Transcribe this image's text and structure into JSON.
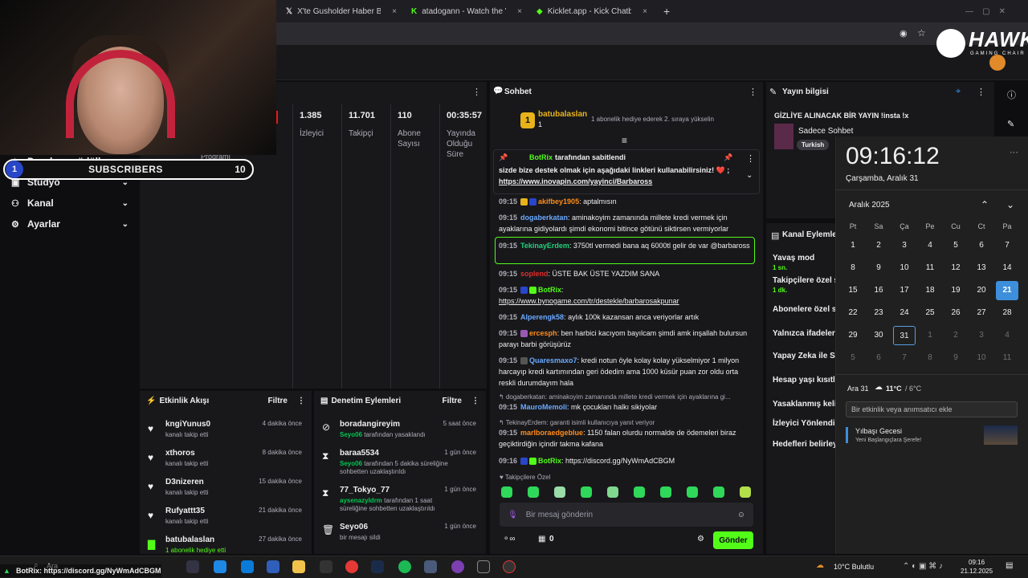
{
  "browser": {
    "tabs": [
      {
        "label": "X'te Gusholder Haber Bülteni: \"",
        "close": "×"
      },
      {
        "label": "atadogann - Watch the VOD o",
        "close": "×"
      },
      {
        "label": "Kicklet.app - Kick Chatbot and",
        "close": "×"
      }
    ],
    "new_tab": "+"
  },
  "overlay": {
    "sub_count_left": "1",
    "subscribers_label": "SUBSCRIBERS",
    "sub_count_right": "10",
    "brand": "HAWK",
    "brand_sub": "GAMING CHAIR",
    "ticker": "BotRix: https://discord.gg/NyWmAdCBGM"
  },
  "sidebar": {
    "items": [
      {
        "label": "Droplar ve ödüller",
        "icon": "gift-icon"
      },
      {
        "label": "Stüdyo",
        "icon": "studio-icon"
      },
      {
        "label": "Kanal",
        "icon": "users-icon"
      },
      {
        "label": "Ayarlar",
        "icon": "gear-icon"
      }
    ],
    "partial_label": "Programı"
  },
  "stats": [
    {
      "value": "1.385",
      "label": "İzleyici"
    },
    {
      "value": "11.701",
      "label": "Takipçi"
    },
    {
      "value": "110",
      "label": "Abone Sayısı"
    },
    {
      "value": "00:35:57",
      "label": "Yayında Olduğu Süre"
    }
  ],
  "feed": {
    "title": "Etkinlik Akışı",
    "filter": "Filtre",
    "items": [
      {
        "name": "kngiYunus0",
        "desc": "kanalı takip etti",
        "time": "4 dakika önce"
      },
      {
        "name": "xthoros",
        "desc": "kanalı takip etti",
        "time": "8 dakika önce"
      },
      {
        "name": "D3nizeren",
        "desc": "kanalı takip etti",
        "time": "15 dakika önce"
      },
      {
        "name": "Rufyattt35",
        "desc": "kanalı takip etti",
        "time": "21 dakika önce"
      },
      {
        "name": "batubalaslan",
        "desc": "1 abonelik hediye etti",
        "time": "27 dakika önce"
      }
    ]
  },
  "modlog": {
    "title": "Denetim Eylemleri",
    "filter": "Filtre",
    "items": [
      {
        "name": "boradangireyim",
        "mod": "Seyo06",
        "desc": "tarafından yasaklandı",
        "time": "5 saat önce",
        "icon": "ban-icon"
      },
      {
        "name": "baraa5534",
        "mod": "Seyo06",
        "desc": "tarafından 5 dakika süreliğine sohbetten uzaklaştırıldı",
        "time": "1 gün önce",
        "icon": "hourglass-icon"
      },
      {
        "name": "77_Tokyo_77",
        "mod": "aysenazyldrm",
        "desc": "tarafından 1 saat süreliğine sohbetten uzaklaştırıldı",
        "time": "1 gün önce",
        "icon": "hourglass-icon"
      },
      {
        "name": "Seyo06",
        "mod": "",
        "desc": "bir mesajı sildi",
        "time": "1 gün önce",
        "icon": "trash-icon"
      }
    ]
  },
  "chat": {
    "title": "Sohbet",
    "gift_user": "batubalaslan",
    "gift_rank": "1",
    "gift_count": "1",
    "gift_text": "1 abonelik hediye ederek 2. sıraya yükselin",
    "pinned_by": "BotRix",
    "pinned_suffix": "tarafından sabitlendi",
    "pinned_text": "sizde bize destek olmak için aşağıdaki linkleri kullanabilirsiniz! ❤️ ;",
    "pinned_link": "https://www.inovapin.com/yayinci/Barbaross",
    "messages": [
      {
        "time": "09:15",
        "user": "akifbey1905",
        "color": "#ff8c1a",
        "text": ": aptalmısın"
      },
      {
        "time": "09:15",
        "user": "dogaberkatan",
        "color": "#6aa9ff",
        "text": ": aminakoyim zamanında millete kredi vermek için ayaklarına gidiyolardı şimdi ekonomi bitince götünü siktirsen vermiyorlar"
      },
      {
        "time": "09:15",
        "user": "TekinayErdem",
        "color": "#21d17a",
        "text": ": 3750tl vermedi bana aq 6000tl gelir de var @barbaross"
      },
      {
        "time": "09:15",
        "user": "soplend",
        "color": "#e02c2c",
        "text": ": ÜSTE BAK ÜSTE YAZDIM SANA"
      },
      {
        "time": "09:15",
        "user": "BotRix",
        "color": "#53fc18",
        "text": ":"
      },
      {
        "time": "",
        "user": "",
        "color": "#efeff1",
        "text": "https://www.bynogame.com/tr/destekle/barbarosakpunar"
      },
      {
        "time": "09:15",
        "user": "Alperengk58",
        "color": "#6aa9ff",
        "text": ": aylık 100k kazansan anca veriyorlar artık"
      },
      {
        "time": "09:15",
        "user": "ercesph",
        "color": "#ff8c1a",
        "text": ": ben harbici kacıyom bayılcam şimdi amk inşallah bulursun parayı barbi görüşürüz"
      },
      {
        "time": "09:15",
        "user": "Quaresmaxo7",
        "color": "#6aa9ff",
        "text": ": kredi notun öyle kolay kolay yükselmiyor 1 milyon harcayıp kredi kartımından geri ödedim ama 1000 küsür puan zor oldu orta reskli durumdayım hala"
      },
      {
        "time": "",
        "user": "",
        "color": "#adadb8",
        "text": "dogaberkatan: aminakoyim zamanında millete kredi vermek için ayaklarına gi..."
      },
      {
        "time": "09:15",
        "user": "MauroMemoli",
        "color": "#6aa9ff",
        "text": ": mk çocukları halkı sikiyolar"
      },
      {
        "time": "",
        "user": "",
        "color": "#adadb8",
        "text": "TekinayErdem: garanti isimli kullanıcıya yanıt veriyor"
      },
      {
        "time": "09:15",
        "user": "marlboraedgeblue",
        "color": "#ff8c1a",
        "text": ": 1150 falan olurdu normalde de ödemeleri biraz geçiktirdiğin içindir takma kafana"
      },
      {
        "time": "09:16",
        "user": "BotRix",
        "color": "#53fc18",
        "text": ": https://discord.gg/NyWmAdCBGM"
      }
    ],
    "emote_label": "Takipçilere Özel",
    "input_placeholder": "Bir mesaj gönderin",
    "points": "0",
    "send_label": "Gönder"
  },
  "stream_info": {
    "title": "Yayın bilgisi",
    "stream_title": "GİZLİYE ALINACAK BİR YAYIN !insta !x",
    "category": "Sadece Sohbet",
    "tag": "Turkish"
  },
  "channel_actions": {
    "title": "Kanal Eylemleri",
    "items": [
      {
        "label": "Yavaş mod",
        "sub": "1 sn."
      },
      {
        "label": "Takipçilere özel so",
        "sub": "1 dk."
      },
      {
        "label": "Abonelere özel so",
        "sub": ""
      },
      {
        "label": "Yalnızca ifadeler",
        "sub": ""
      },
      {
        "label": "Yapay Zeka ile So",
        "sub": ""
      },
      {
        "label": "Hesap yaşı kısıtla",
        "sub": ""
      },
      {
        "label": "Yasaklanmış kelin",
        "sub": ""
      },
      {
        "label": "İzleyici Yönlendir",
        "sub": ""
      },
      {
        "label": "Hedefleri belirleyi",
        "sub": ""
      }
    ]
  },
  "clock": {
    "time": "09:16:12",
    "date": "Çarşamba, Aralık 31",
    "month": "Aralık 2025",
    "weekdays": [
      "Pt",
      "Sa",
      "Ça",
      "Pe",
      "Cu",
      "Ct",
      "Pa"
    ],
    "days": [
      [
        "1",
        "2",
        "3",
        "4",
        "5",
        "6",
        "7"
      ],
      [
        "8",
        "9",
        "10",
        "11",
        "12",
        "13",
        "14"
      ],
      [
        "15",
        "16",
        "17",
        "18",
        "19",
        "20",
        "21"
      ],
      [
        "22",
        "23",
        "24",
        "25",
        "26",
        "27",
        "28"
      ],
      [
        "29",
        "30",
        "31",
        "1",
        "2",
        "3",
        "4"
      ],
      [
        "5",
        "6",
        "7",
        "8",
        "9",
        "10",
        "11"
      ]
    ],
    "today": "21",
    "selected": "31",
    "weather_date": "Ara 31",
    "weather_high": "11°C",
    "weather_low": "/ 6°C",
    "event_placeholder": "Bir etkinlik veya anımsatıcı ekle",
    "event_title": "Yılbaşı Gecesi",
    "event_sub": "Yeni Başlangıçlara Şerefe!"
  },
  "taskbar": {
    "search": "Ara",
    "weather": "10°C  Bulutlu",
    "time": "09:16",
    "date": "21.12.2025"
  },
  "colors": {
    "accent": "#53fc18",
    "panel": "#18181b",
    "bg": "#0e0e10",
    "today": "#3d8fdb"
  }
}
